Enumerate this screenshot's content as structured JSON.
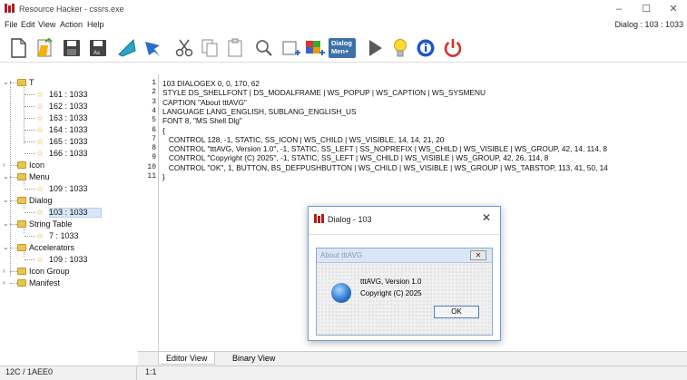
{
  "window": {
    "title": "Resource Hacker - cssrs.exe",
    "dialog_info": "Dialog : 103 : 1033"
  },
  "menubar": [
    "File",
    "Edit",
    "View",
    "Action",
    "Help"
  ],
  "toolbar_icons": [
    "new-file-icon",
    "open-file-icon",
    "save-icon",
    "save-as-icon",
    "compile-icon",
    "script-icon",
    "cut-icon",
    "copy-icon",
    "paste-icon",
    "find-icon",
    "add-resource-icon",
    "add-image-icon",
    "dialog-merger-icon",
    "run-icon",
    "tip-icon",
    "info-icon",
    "power-icon"
  ],
  "toolbar": {
    "dialog_menu_top": "Dialog",
    "dialog_menu_bottom": "Men+"
  },
  "tree": [
    {
      "label": "T",
      "kind": "folder"
    },
    {
      "label": "161 : 1033",
      "kind": "item"
    },
    {
      "label": "162 : 1033",
      "kind": "item"
    },
    {
      "label": "163 : 1033",
      "kind": "item"
    },
    {
      "label": "164 : 1033",
      "kind": "item"
    },
    {
      "label": "165 : 1033",
      "kind": "item"
    },
    {
      "label": "166 : 1033",
      "kind": "item"
    },
    {
      "label": "Icon",
      "kind": "folder"
    },
    {
      "label": "Menu",
      "kind": "folder"
    },
    {
      "label": "109 : 1033",
      "kind": "item"
    },
    {
      "label": "Dialog",
      "kind": "folder"
    },
    {
      "label": "103 : 1033",
      "kind": "item",
      "selected": true
    },
    {
      "label": "String Table",
      "kind": "folder"
    },
    {
      "label": "7 : 1033",
      "kind": "item"
    },
    {
      "label": "Accelerators",
      "kind": "folder"
    },
    {
      "label": "109 : 1033",
      "kind": "item"
    },
    {
      "label": "Icon Group",
      "kind": "folder"
    },
    {
      "label": "Manifest",
      "kind": "folder"
    }
  ],
  "code_lines": [
    "103 DIALOGEX 0, 0, 170, 62",
    "STYLE DS_SHELLFONT | DS_MODALFRAME | WS_POPUP | WS_CAPTION | WS_SYSMENU",
    "CAPTION \"About tttAVG\"",
    "LANGUAGE LANG_ENGLISH, SUBLANG_ENGLISH_US",
    "FONT 8, \"MS Shell Dlg\"",
    "{",
    "   CONTROL 128, -1, STATIC, SS_ICON | WS_CHILD | WS_VISIBLE, 14, 14, 21, 20",
    "   CONTROL \"tttAVG, Version 1.0\", -1, STATIC, SS_LEFT | SS_NOPREFIX | WS_CHILD | WS_VISIBLE | WS_GROUP, 42, 14, 114, 8",
    "   CONTROL \"Copyright (C) 2025\", -1, STATIC, SS_LEFT | WS_CHILD | WS_VISIBLE | WS_GROUP, 42, 26, 114, 8",
    "   CONTROL \"OK\", 1, BUTTON, BS_DEFPUSHBUTTON | WS_CHILD | WS_VISIBLE | WS_GROUP | WS_TABSTOP, 113, 41, 50, 14",
    "}"
  ],
  "preview": {
    "title": "Dialog - 103",
    "close": "✕",
    "inner_caption": "About tttAVG",
    "inner_close": "✕",
    "version": "tttAVG, Version 1.0",
    "copyright": "Copyright (C) 2025",
    "ok": "OK"
  },
  "tabs": {
    "editor": "Editor View",
    "binary": "Binary View"
  },
  "status": {
    "left": "12C / 1AEE0",
    "right": "1:1"
  },
  "colors": {
    "accent": "#2b72c9",
    "folder": "#e8c450",
    "star": "#e2a300",
    "close_red": "#d9312a"
  }
}
